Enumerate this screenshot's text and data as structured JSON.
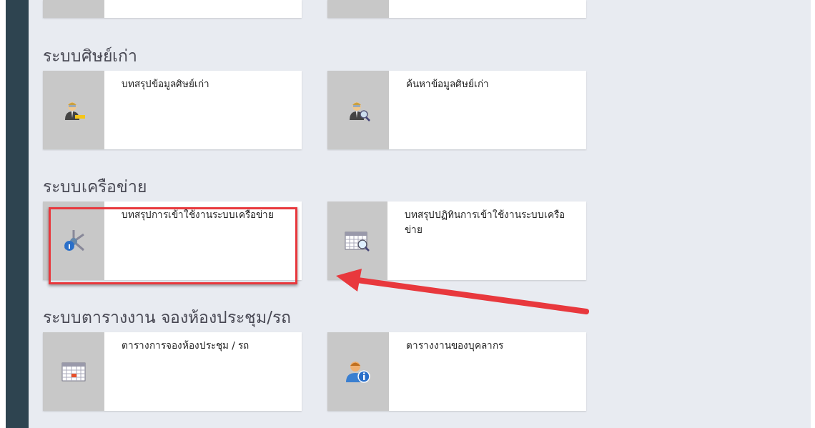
{
  "sections": [
    {
      "heading": "ระบบศิษย์เก่า",
      "cards": [
        {
          "title": "บทสรุปข้อมูลศิษย์เก่า",
          "highlighted": false
        },
        {
          "title": "ค้นหาข้อมูลศิษย์เก่า",
          "highlighted": false
        }
      ]
    },
    {
      "heading": "ระบบเครือข่าย",
      "cards": [
        {
          "title": "บทสรุปการเข้าใช้งานระบบเครือข่าย",
          "highlighted": true
        },
        {
          "title": "บทสรุปปฏิทินการเข้าใช้งานระบบเครือข่าย",
          "highlighted": false
        }
      ]
    },
    {
      "heading": "ระบบตารางงาน จองห้องประชุม/รถ",
      "cards": [
        {
          "title": "ตารางการจองห้องประชุม / รถ",
          "highlighted": false
        },
        {
          "title": "ตารางงานของบุคลากร",
          "highlighted": false
        }
      ]
    }
  ]
}
